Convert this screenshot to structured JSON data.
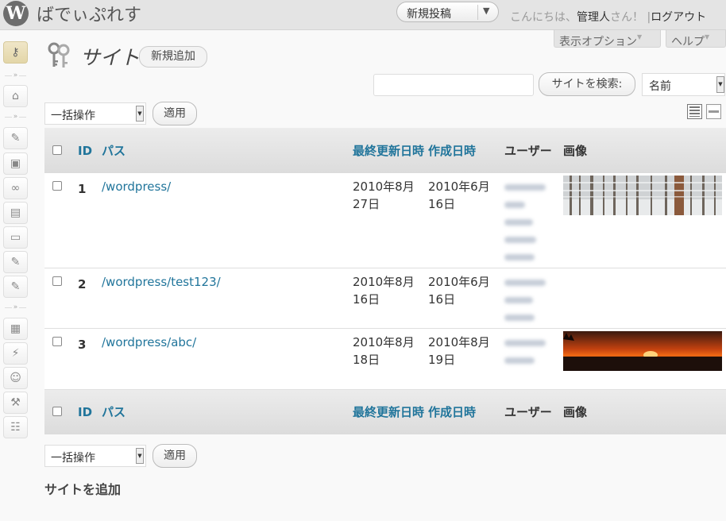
{
  "header": {
    "logo": "W",
    "site_title": "ばでぃぷれす",
    "favorite_action": "新規投稿",
    "greeting_prefix": "こんにちは、",
    "user_name": "管理人",
    "greeting_suffix": "さん！",
    "separator": "|",
    "logout": "ログアウト"
  },
  "screen_tabs": {
    "screen_options": "表示オプション",
    "help": "ヘルプ",
    "triangle": "▼"
  },
  "page": {
    "title": "サイト",
    "add_new": "新規追加"
  },
  "search": {
    "placeholder": "",
    "button": "サイトを検索:",
    "sort_value": "名前"
  },
  "bulk": {
    "selected": "一括操作",
    "apply": "適用"
  },
  "table": {
    "columns": [
      "ID",
      "パス",
      "最終更新日時",
      "作成日時",
      "ユーザー",
      "画像"
    ],
    "rows": [
      {
        "id": "1",
        "path": "/wordpress/",
        "modified_line1": "2010年8月",
        "modified_line2": "27日",
        "created_line1": "2010年6月",
        "created_line2": "16日",
        "user_count": 5,
        "image": "snow-forest"
      },
      {
        "id": "2",
        "path": "/wordpress/test123/",
        "modified_line1": "2010年8月",
        "modified_line2": "16日",
        "created_line1": "2010年6月",
        "created_line2": "16日",
        "user_count": 3,
        "image": ""
      },
      {
        "id": "3",
        "path": "/wordpress/abc/",
        "modified_line1": "2010年8月",
        "modified_line2": "18日",
        "created_line1": "2010年8月",
        "created_line2": "19日",
        "user_count": 2,
        "image": "sunset"
      }
    ]
  },
  "footer_section": {
    "add_site_heading": "サイトを追加"
  },
  "sidebar_icons": [
    "sites-icon",
    "home-icon",
    "posts-icon",
    "media-icon",
    "links-icon",
    "pages-icon",
    "comments-icon",
    "pin-icon",
    "pin-icon-2",
    "appearance-icon",
    "plugins-icon",
    "users-icon",
    "tools-icon",
    "settings-icon"
  ],
  "colors": {
    "link": "#21759b",
    "header_bg": "#e4e4e4",
    "page_bg": "#f9f9f9"
  }
}
